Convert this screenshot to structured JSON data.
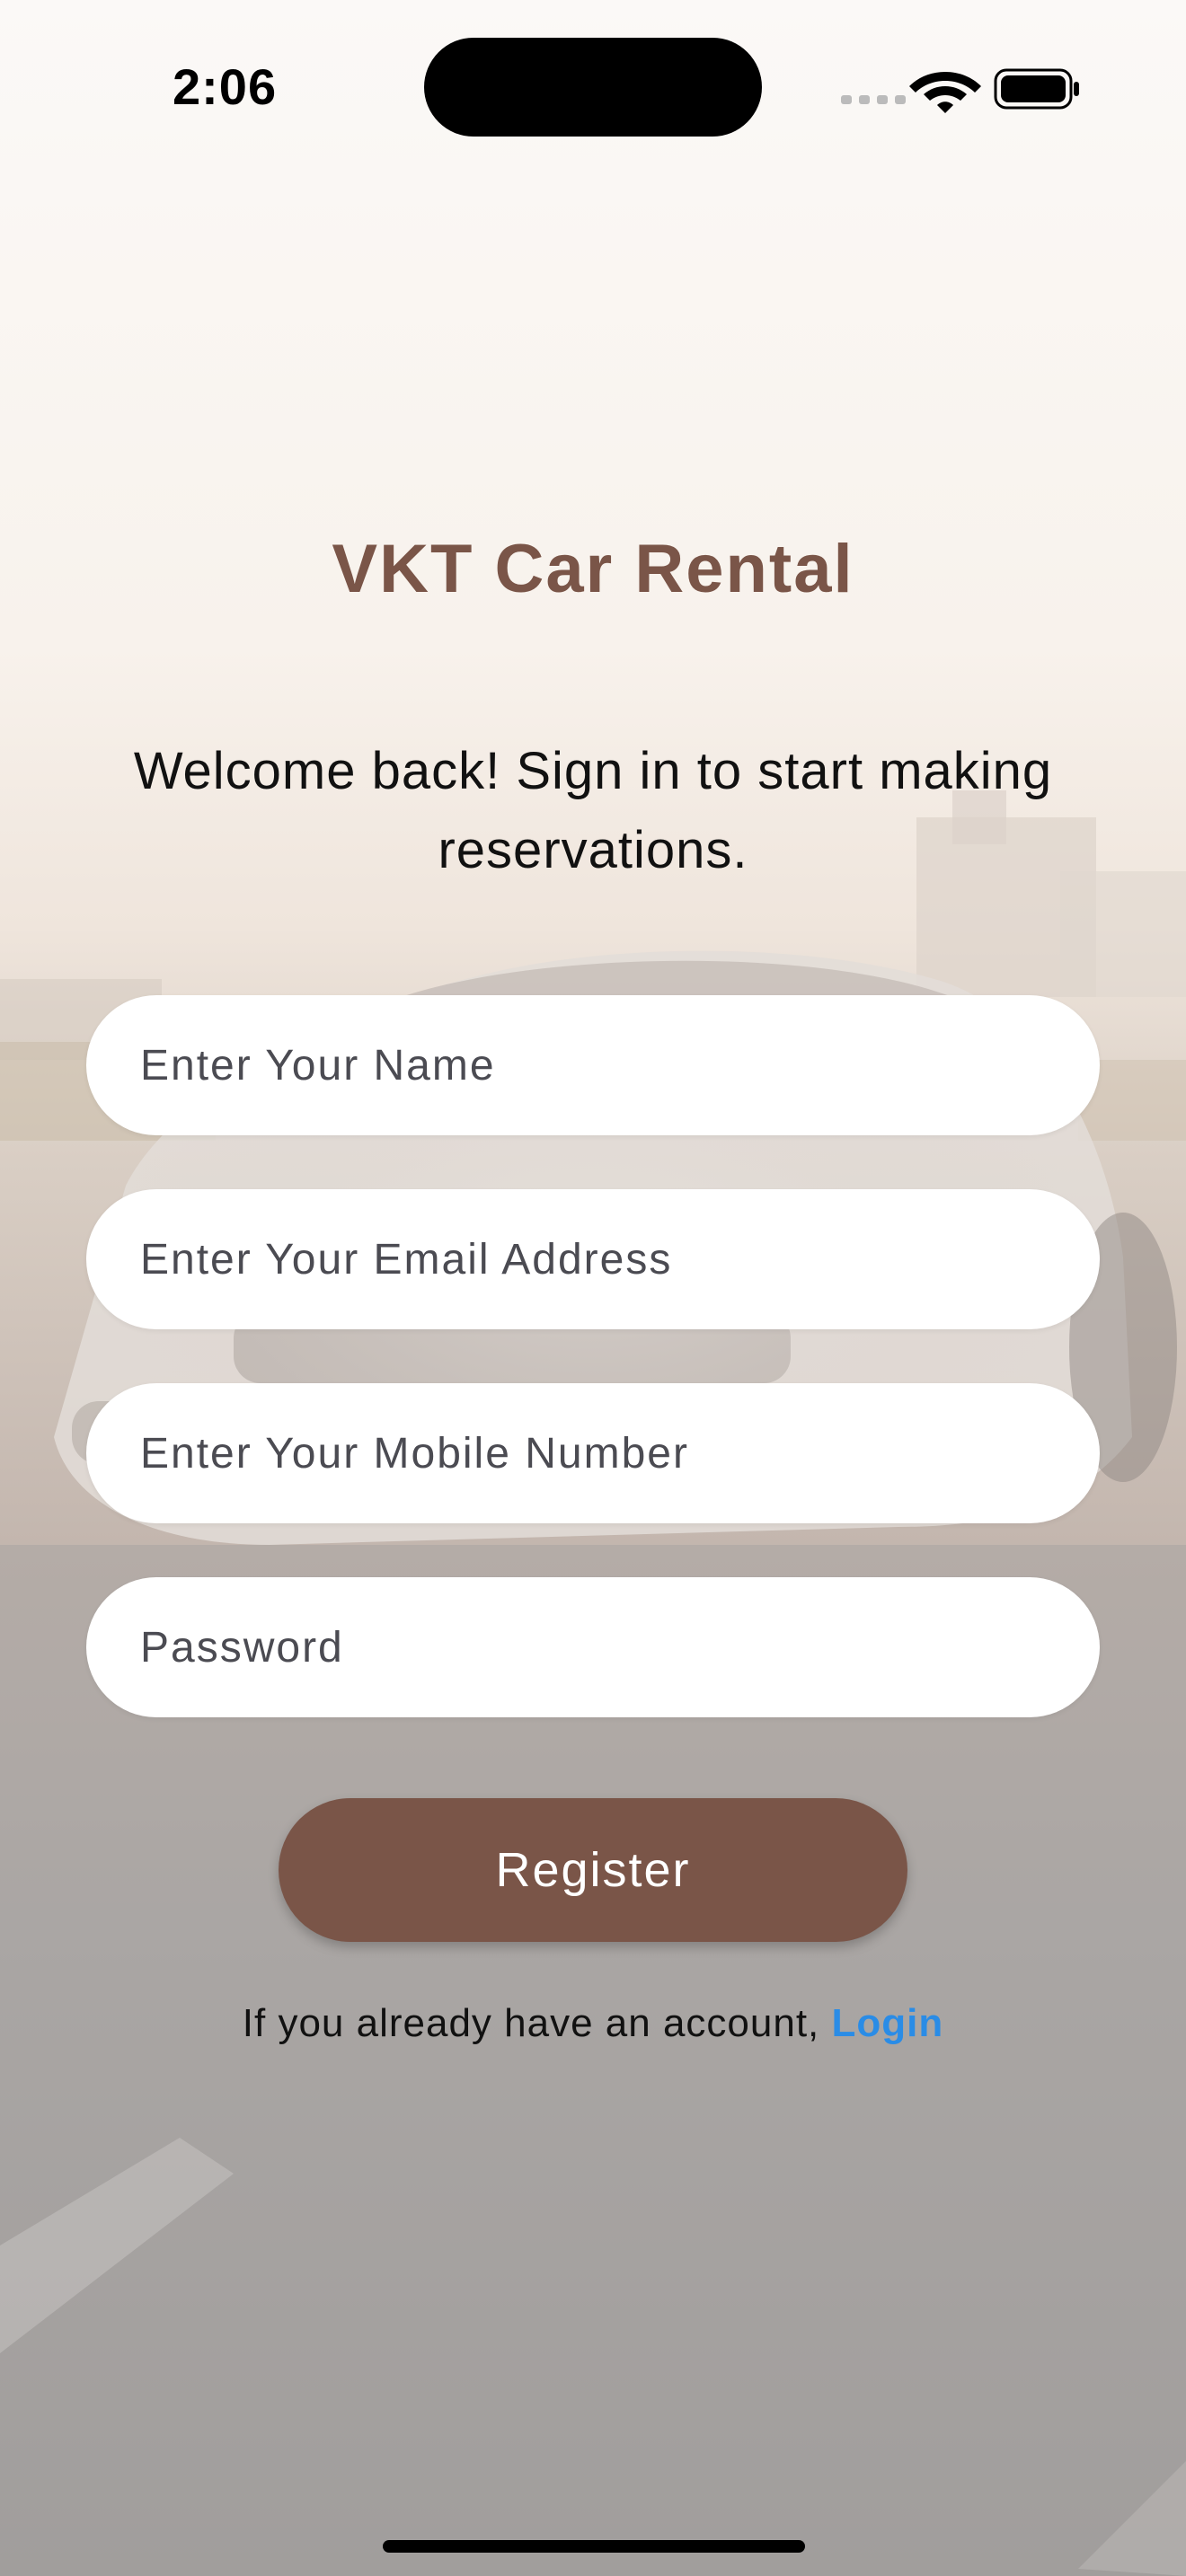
{
  "status_bar": {
    "time": "2:06",
    "icons": [
      "cellular-icon",
      "wifi-icon",
      "battery-icon"
    ]
  },
  "app": {
    "title": "VKT Car Rental",
    "welcome": "Welcome back! Sign in to start making reservations."
  },
  "form": {
    "name_placeholder": "Enter Your Name",
    "email_placeholder": "Enter Your Email Address",
    "mobile_placeholder": "Enter Your Mobile Number",
    "password_placeholder": "Password",
    "register_label": "Register"
  },
  "footer": {
    "prompt": "If you already have an account, ",
    "login_label": "Login"
  },
  "colors": {
    "brand": "#7a5548",
    "link": "#2a8ce6",
    "field_bg": "#ffffff"
  }
}
